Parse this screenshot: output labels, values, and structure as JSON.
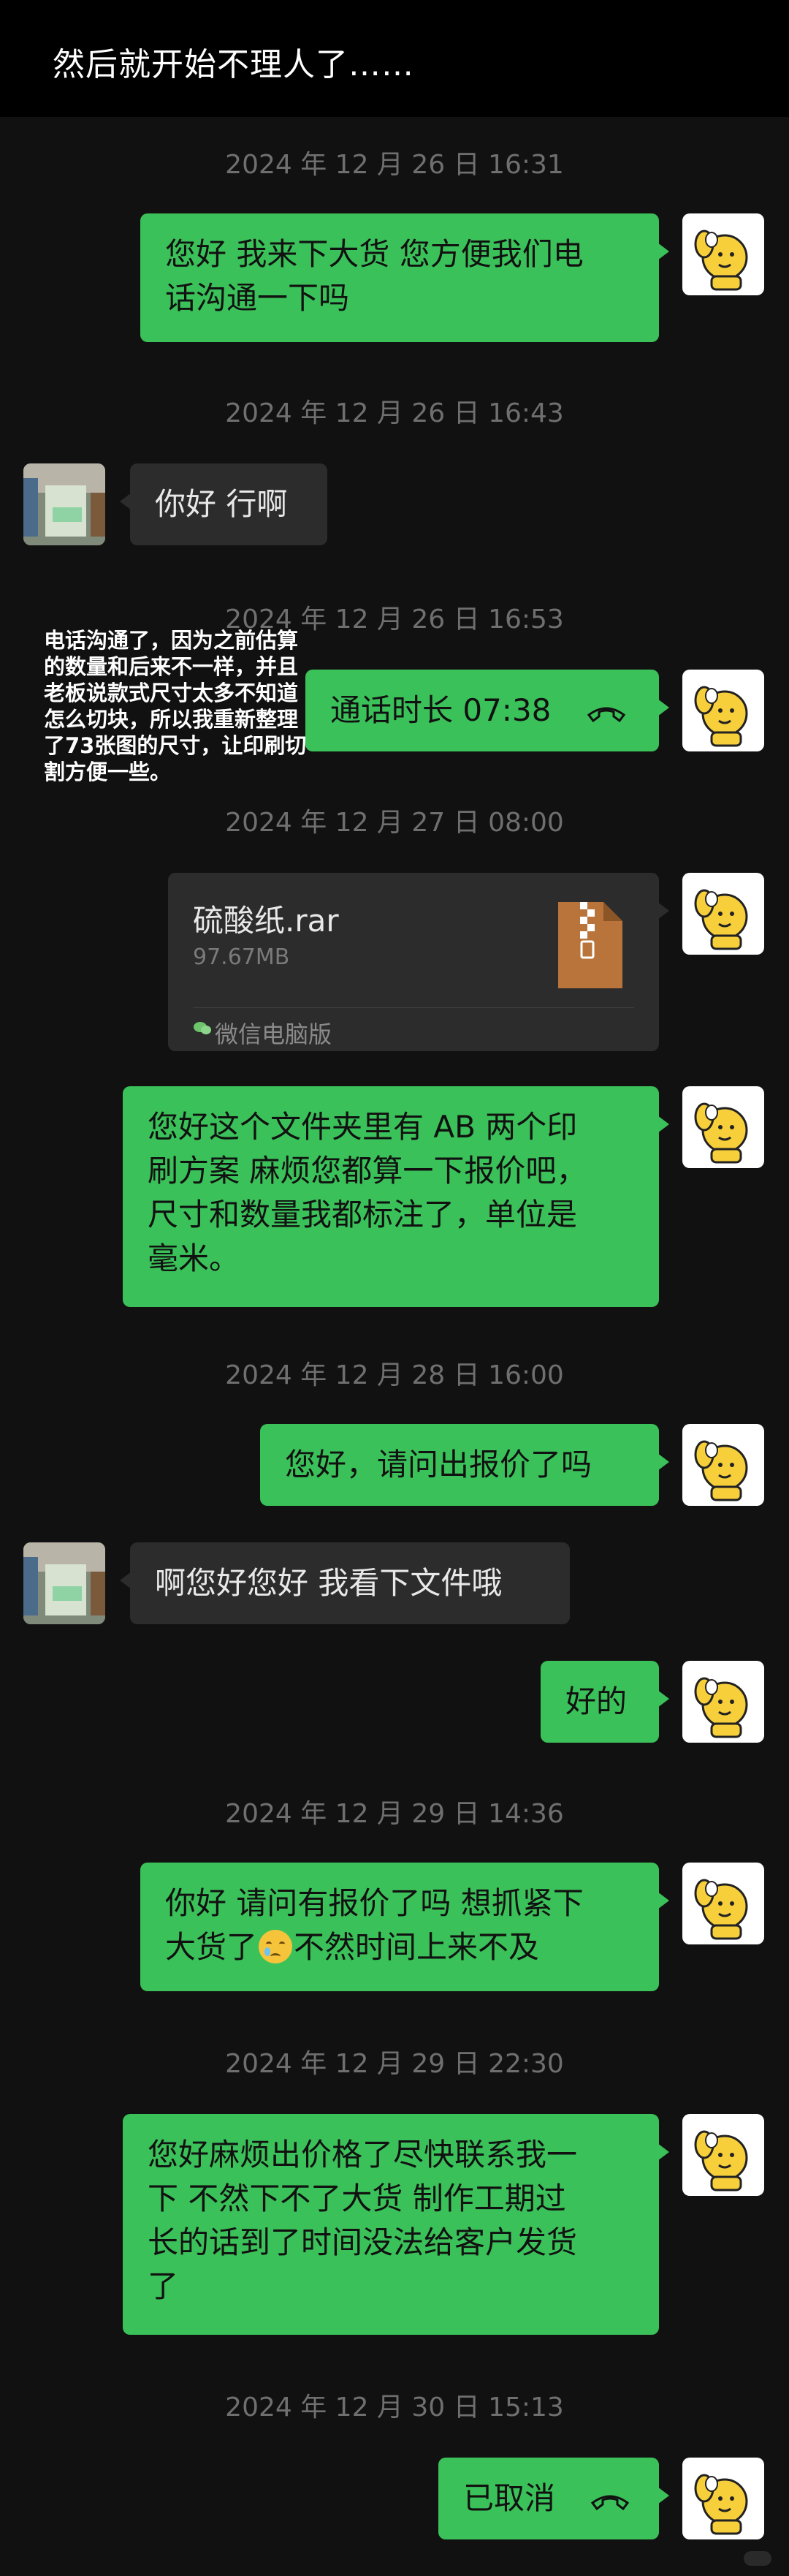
{
  "header": {
    "title": "然后就开始不理人了……"
  },
  "note": "电话沟通了，因为之前估算的数量和后来不一样，并且老板说款式尺寸太多不知道怎么切块，所以我重新整理了73张图的尺寸，让印刷切割方便一些。",
  "timestamps": [
    "2024 年 12 月 26 日 16:31",
    "2024 年 12 月 26 日 16:43",
    "2024 年 12 月 26 日 16:53",
    "2024 年 12 月 27 日 08:00",
    "2024 年 12 月 28 日 16:00",
    "2024 年 12 月 29 日 14:36",
    "2024 年 12 月 29 日 22:30",
    "2024 年 12 月 30 日 15:13"
  ],
  "messages": {
    "m1_line1": "您好 我来下大货 您方便我们电",
    "m1_line2": "话沟通一下吗",
    "m2": "你好 行啊",
    "m3_call": "通话时长 07:38",
    "m5_line1": "您好这个文件夹里有 AB 两个印",
    "m5_line2": "刷方案 麻烦您都算一下报价吧，",
    "m5_line3": "尺寸和数量我都标注了，单位是",
    "m5_line4": "毫米。",
    "m6": "您好，请问出报价了吗",
    "m7": "啊您好您好 我看下文件哦",
    "m8": "好的",
    "m9_line1": "你好 请问有报价了吗 想抓紧下",
    "m9_line2a": "大货了",
    "m9_line2b": "不然时间上来不及",
    "m10_line1": "您好麻烦出价格了尽快联系我一",
    "m10_line2": "下 不然下不了大货 制作工期过",
    "m10_line3": "长的话到了时间没法给客户发货",
    "m10_line4": "了",
    "m11_call": "已取消"
  },
  "file": {
    "name": "硫酸纸.rar",
    "size": "97.67MB",
    "source": "微信电脑版"
  },
  "colors": {
    "my_bubble": "#3bc159",
    "their_bubble": "#2c2c2c",
    "background": "#111111"
  }
}
